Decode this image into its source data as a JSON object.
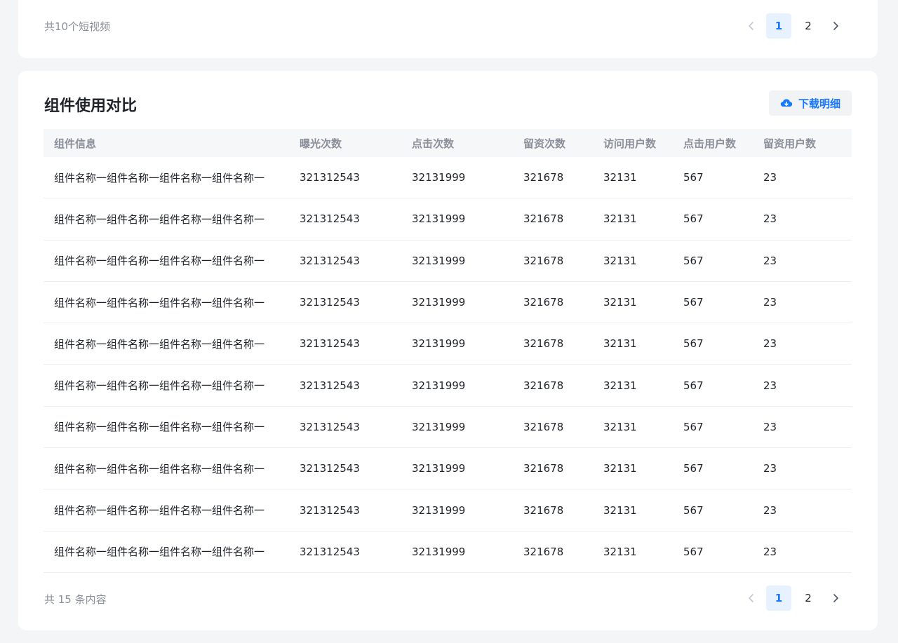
{
  "top_section": {
    "total_text": "共10个短视频",
    "pagination": {
      "pages": [
        "1",
        "2"
      ],
      "current": "1"
    }
  },
  "main_section": {
    "title": "组件使用对比",
    "download_label": "下载明细",
    "table": {
      "headers": [
        "组件信息",
        "曝光次数",
        "点击次数",
        "留资次数",
        "访问用户数",
        "点击用户数",
        "留资用户数"
      ],
      "rows": [
        [
          "组件名称一组件名称一组件名称一组件名称一",
          "321312543",
          "32131999",
          "321678",
          "32131",
          "567",
          "23"
        ],
        [
          "组件名称一组件名称一组件名称一组件名称一",
          "321312543",
          "32131999",
          "321678",
          "32131",
          "567",
          "23"
        ],
        [
          "组件名称一组件名称一组件名称一组件名称一",
          "321312543",
          "32131999",
          "321678",
          "32131",
          "567",
          "23"
        ],
        [
          "组件名称一组件名称一组件名称一组件名称一",
          "321312543",
          "32131999",
          "321678",
          "32131",
          "567",
          "23"
        ],
        [
          "组件名称一组件名称一组件名称一组件名称一",
          "321312543",
          "32131999",
          "321678",
          "32131",
          "567",
          "23"
        ],
        [
          "组件名称一组件名称一组件名称一组件名称一",
          "321312543",
          "32131999",
          "321678",
          "32131",
          "567",
          "23"
        ],
        [
          "组件名称一组件名称一组件名称一组件名称一",
          "321312543",
          "32131999",
          "321678",
          "32131",
          "567",
          "23"
        ],
        [
          "组件名称一组件名称一组件名称一组件名称一",
          "321312543",
          "32131999",
          "321678",
          "32131",
          "567",
          "23"
        ],
        [
          "组件名称一组件名称一组件名称一组件名称一",
          "321312543",
          "32131999",
          "321678",
          "32131",
          "567",
          "23"
        ],
        [
          "组件名称一组件名称一组件名称一组件名称一",
          "321312543",
          "32131999",
          "321678",
          "32131",
          "567",
          "23"
        ]
      ]
    },
    "total_text": "共 15 条内容",
    "pagination": {
      "pages": [
        "1",
        "2"
      ],
      "current": "1"
    }
  },
  "icons": {
    "prev": "chevron-left-icon",
    "next": "chevron-right-icon",
    "download": "cloud-download-icon"
  },
  "colors": {
    "accent": "#1677ff",
    "active_page_bg": "#e8f1ff",
    "page_bg": "#f4f5f7",
    "muted_text": "#8a8f99"
  }
}
